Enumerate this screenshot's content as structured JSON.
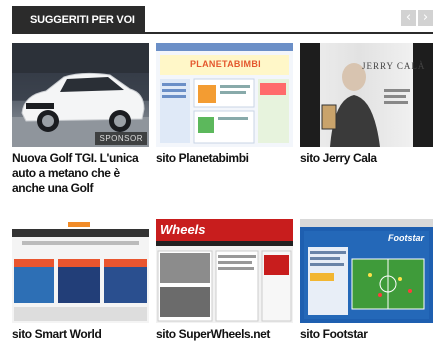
{
  "header": {
    "title": "SUGGERITI PER VOI",
    "prev_label": "‹",
    "next_label": "›"
  },
  "cards": [
    {
      "caption": "Nuova Golf TGI. L'unica auto a metano che è anche una Golf",
      "badge": "SPONSOR",
      "thumb_logo": ""
    },
    {
      "caption": "sito Planetabimbi",
      "thumb_logo": "PLANETABIMBI"
    },
    {
      "caption": "sito Jerry Cala",
      "thumb_logo": "JERRY CALÀ"
    },
    {
      "caption": "sito Smart World",
      "thumb_logo": ""
    },
    {
      "caption": "sito SuperWheels.net",
      "thumb_logo": "Wheels"
    },
    {
      "caption": "sito Footstar",
      "thumb_logo": "Footstar"
    }
  ],
  "colors": {
    "header_bg": "#2b2b2b",
    "nav_bg": "#d2d2d2",
    "text": "#111111"
  }
}
